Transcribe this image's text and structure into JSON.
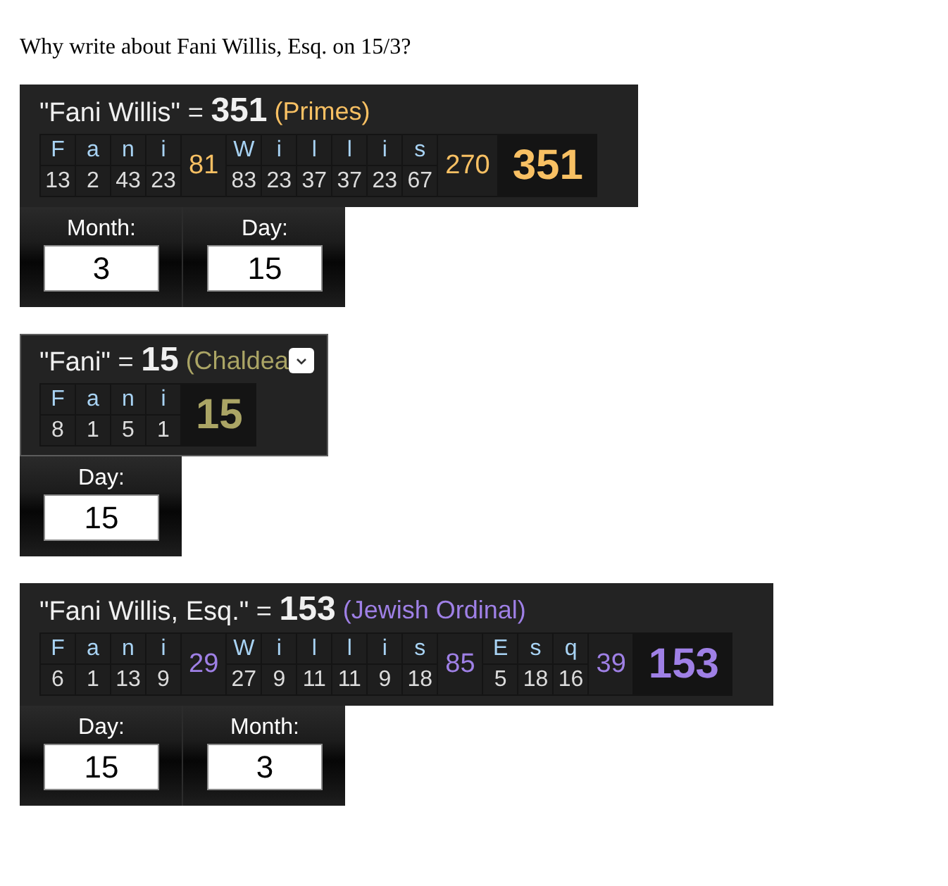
{
  "heading": "Why write about Fani Willis, Esq. on 15/3?",
  "calculations": [
    {
      "equation": "\"Fani Willis\" = **351**",
      "cipher": "(Primes)",
      "color": "#f8c063",
      "hovered": false,
      "words": [
        {
          "letters": [
            {
              "letter": "F",
              "value": "13"
            },
            {
              "letter": "a",
              "value": "2"
            },
            {
              "letter": "n",
              "value": "43"
            },
            {
              "letter": "i",
              "value": "23"
            }
          ],
          "subtotal": "81"
        },
        {
          "letters": [
            {
              "letter": "W",
              "value": "83"
            },
            {
              "letter": "i",
              "value": "23"
            },
            {
              "letter": "l",
              "value": "37"
            },
            {
              "letter": "l",
              "value": "37"
            },
            {
              "letter": "i",
              "value": "23"
            },
            {
              "letter": "s",
              "value": "67"
            }
          ],
          "subtotal": "270"
        }
      ],
      "total": "351",
      "date_panel": {
        "fields": [
          {
            "label": "Month:",
            "value": "3"
          },
          {
            "label": "Day:",
            "value": "15"
          }
        ]
      }
    },
    {
      "equation": "\"Fani\" = **15**",
      "cipher": "(Chaldea",
      "color": "#aba565",
      "hovered": true,
      "words": [
        {
          "letters": [
            {
              "letter": "F",
              "value": "8"
            },
            {
              "letter": "a",
              "value": "1"
            },
            {
              "letter": "n",
              "value": "5"
            },
            {
              "letter": "i",
              "value": "1"
            }
          ]
        }
      ],
      "total": "15",
      "date_panel": {
        "fields": [
          {
            "label": "Day:",
            "value": "15"
          }
        ]
      }
    },
    {
      "equation": "\"Fani Willis, Esq.\" = **153**",
      "cipher": "(Jewish Ordinal)",
      "color": "#9f80e6",
      "hovered": false,
      "words": [
        {
          "letters": [
            {
              "letter": "F",
              "value": "6"
            },
            {
              "letter": "a",
              "value": "1"
            },
            {
              "letter": "n",
              "value": "13"
            },
            {
              "letter": "i",
              "value": "9"
            }
          ],
          "subtotal": "29"
        },
        {
          "letters": [
            {
              "letter": "W",
              "value": "27"
            },
            {
              "letter": "i",
              "value": "9"
            },
            {
              "letter": "l",
              "value": "11"
            },
            {
              "letter": "l",
              "value": "11"
            },
            {
              "letter": "i",
              "value": "9"
            },
            {
              "letter": "s",
              "value": "18"
            }
          ],
          "subtotal": "85"
        },
        {
          "letters": [
            {
              "letter": "E",
              "value": "5"
            },
            {
              "letter": "s",
              "value": "18"
            },
            {
              "letter": "q",
              "value": "16"
            }
          ],
          "subtotal": "39"
        }
      ],
      "total": "153",
      "date_panel": {
        "fields": [
          {
            "label": "Day:",
            "value": "15"
          },
          {
            "label": "Month:",
            "value": "3"
          }
        ]
      }
    }
  ]
}
